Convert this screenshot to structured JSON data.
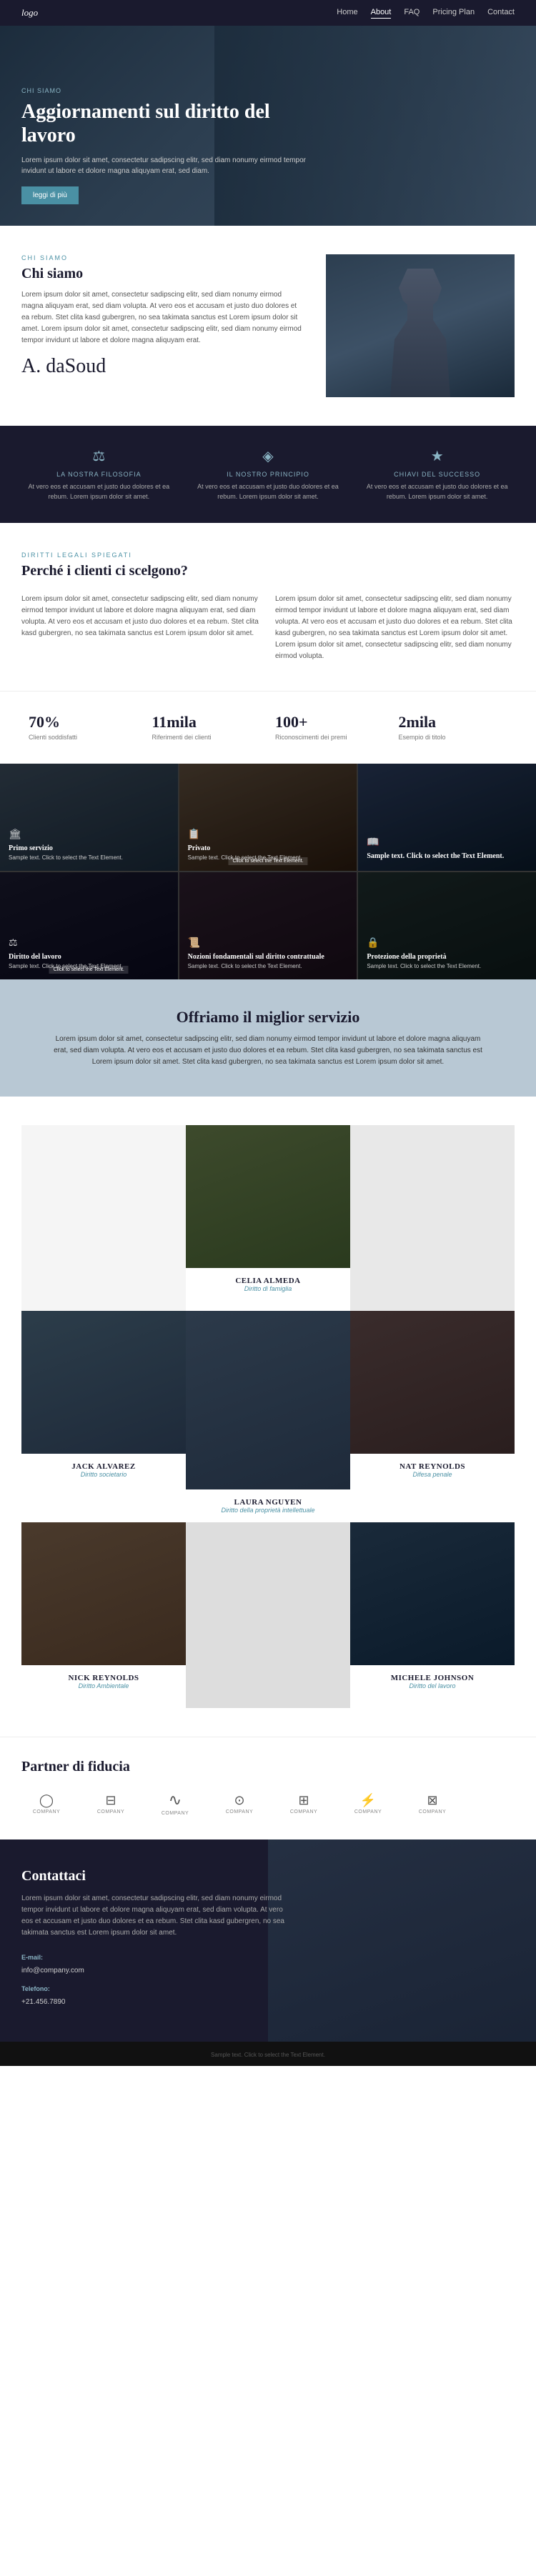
{
  "nav": {
    "logo": "logo",
    "links": [
      "Home",
      "About",
      "FAQ",
      "Pricing Plan",
      "Contact"
    ],
    "active": "About"
  },
  "hero": {
    "tag": "CHI SIAMO",
    "title": "Aggiornamenti sul diritto del lavoro",
    "description": "Lorem ipsum dolor sit amet, consectetur sadipscing elitr, sed diam nonumy eirmod tempor invidunt ut labore et dolore magna aliquyam erat, sed diam.",
    "button": "Leggi di più"
  },
  "about": {
    "label": "Chi siamo",
    "title": "Chi siamo",
    "text": "Lorem ipsum dolor sit amet, consectetur sadipscing elitr, sed diam nonumy eirmod magna aliquyam erat, sed diam volupta. At vero eos et accusam et justo duo dolores et ea rebum. Stet clita kasd gubergren, no sea takimata sanctus est Lorem ipsum dolor sit amet. Lorem ipsum dolor sit amet, consectetur sadipscing elitr, sed diam nonumy eirmod tempor invidunt ut labore et dolore magna aliquyam erat.",
    "signature": "A. daSoud"
  },
  "principles": [
    {
      "icon": "⚖",
      "label": "LA NOSTRA FILOSOFIA",
      "text": "At vero eos et accusam et justo duo dolores et ea rebum. Lorem ipsum dolor sit amet."
    },
    {
      "icon": "◈",
      "label": "IL NOSTRO PRINCIPIO",
      "text": "At vero eos et accusam et justo duo dolores et ea rebum. Lorem ipsum dolor sit amet."
    },
    {
      "icon": "★",
      "label": "CHIAVI DEL SUCCESSO",
      "text": "At vero eos et accusam et justo duo dolores et ea rebum. Lorem ipsum dolor sit amet."
    }
  ],
  "why": {
    "label": "DIRITTI LEGALI SPIEGATI",
    "title": "Perché i clienti ci scelgono?",
    "text_left": "Lorem ipsum dolor sit amet, consectetur sadipscing elitr, sed diam nonumy eirmod tempor invidunt ut labore et dolore magna aliquyam erat, sed diam volupta. At vero eos et accusam et justo duo dolores et ea rebum. Stet clita kasd gubergren, no sea takimata sanctus est Lorem ipsum dolor sit amet.",
    "text_right": "Lorem ipsum dolor sit amet, consectetur sadipscing elitr, sed diam nonumy eirmod tempor invidunt ut labore et dolore magna aliquyam erat, sed diam volupta. At vero eos et accusam et justo duo dolores et ea rebum. Stet clita kasd gubergren, no sea takimata sanctus est Lorem ipsum dolor sit amet. Lorem ipsum dolor sit amet, consectetur sadipscing elitr, sed diam nonumy eirmod volupta."
  },
  "stats": [
    {
      "number": "70%",
      "label": "Clienti soddisfatti"
    },
    {
      "number": "11mila",
      "label": "Riferimenti dei clienti"
    },
    {
      "number": "100+",
      "label": "Riconoscimenti dei premi"
    },
    {
      "number": "2mila",
      "label": "Esempio di titolo"
    }
  ],
  "services": [
    {
      "icon": "🏛",
      "title": "Primo servizio",
      "sample": "Sample text. Click to select the Text Element.",
      "tag": "Primo"
    },
    {
      "icon": "📋",
      "title": "Privato",
      "sample": "Sample text. Click to select the Text Element.",
      "tag": "Privato"
    },
    {
      "icon": "📖",
      "title": "Sample text. Click to select the Text Element.",
      "sample": "",
      "tag": ""
    },
    {
      "icon": "⚖",
      "title": "Diritto del lavoro",
      "sample": "Sample text. Click to select the Text Element.",
      "tag": ""
    },
    {
      "icon": "📜",
      "title": "Nozioni fondamentali sul diritto contrattuale",
      "sample": "Sample text. Click to select the Text Element.",
      "tag": ""
    },
    {
      "icon": "🔒",
      "title": "Protezione della proprietà",
      "sample": "Sample text. Click to select the Text Element.",
      "tag": ""
    }
  ],
  "best_service": {
    "title": "Offriamo il miglior servizio",
    "text": "Lorem ipsum dolor sit amet, consectetur sadipscing elitr, sed diam nonumy eirmod tempor invidunt ut labore et dolore magna aliquyam erat, sed diam volupta. At vero eos et accusam et justo duo dolores et ea rebum. Stet clita kasd gubergren, no sea takimata sanctus est Lorem ipsum dolor sit amet. Stet clita kasd gubergren, no sea takimata sanctus est Lorem ipsum dolor sit amet."
  },
  "team": {
    "members": [
      {
        "name": "CELIA ALMEDA",
        "role": "Diritto di famiglia",
        "photo": "p1"
      },
      {
        "name": "JACK ALVAREZ",
        "role": "Diritto societario",
        "photo": "p2"
      },
      {
        "name": "NAT REYNOLDS",
        "role": "Difesa penale",
        "photo": "p3"
      },
      {
        "name": "LAURA NGUYEN",
        "role": "Diritto della proprietà intellettuale",
        "photo": "p4"
      },
      {
        "name": "NICK REYNOLDS",
        "role": "Diritto Ambientale",
        "photo": "p5"
      },
      {
        "name": "MICHELE JOHNSON",
        "role": "Diritto del lavoro",
        "photo": "p6"
      }
    ]
  },
  "partners": {
    "title": "Partner di fiducia",
    "logos": [
      {
        "icon": "◯",
        "name": "COMPANY"
      },
      {
        "icon": "⊟",
        "name": "COMPANY"
      },
      {
        "icon": "∿",
        "name": "COMPANY"
      },
      {
        "icon": "⊙",
        "name": "COMPANY"
      },
      {
        "icon": "⊞",
        "name": "COMPANY"
      },
      {
        "icon": "⚡",
        "name": "COMPANY"
      },
      {
        "icon": "⊠",
        "name": "COMPANY"
      }
    ]
  },
  "contact": {
    "title": "Contattaci",
    "text": "Lorem ipsum dolor sit amet, consectetur sadipscing elitr, sed diam nonumy eirmod tempor invidunt ut labore et dolore magna aliquyam erat, sed diam volupta. At vero eos et accusam et justo duo dolores et ea rebum. Stet clita kasd gubergren, no sea takimata sanctus est Lorem ipsum dolor sit amet.",
    "email_label": "E-mail:",
    "email": "info@company.com",
    "phone_label": "Telefono:",
    "phone": "+21.456.7890"
  },
  "footer": {
    "sample_text": "Sample text. Click to select the Text Element."
  }
}
